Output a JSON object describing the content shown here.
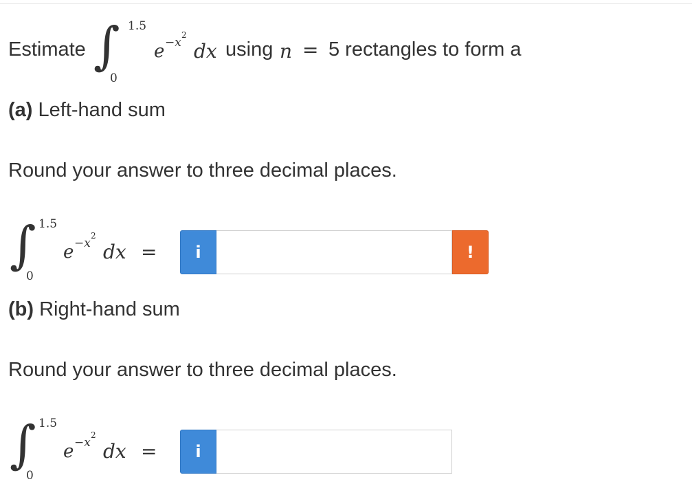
{
  "question": {
    "intro_word": "Estimate",
    "integral": {
      "upper": "1.5",
      "lower": "0",
      "base": "e",
      "exponent": "−x",
      "exponent_power": "2",
      "differential": "dx"
    },
    "middle_text": "using",
    "n_var": "n",
    "equals": "=",
    "tail_text": "5 rectangles to form a"
  },
  "part_a": {
    "label": "(a)",
    "title": "Left-hand sum",
    "instruction": "Round your answer to three decimal places.",
    "integral": {
      "upper": "1.5",
      "lower": "0",
      "base": "e",
      "exponent": "−x",
      "exponent_power": "2",
      "differential": "dx",
      "equals": "="
    },
    "info_icon": "info-icon",
    "info_glyph": "i",
    "answer_value": "",
    "warning_icon": "exclamation-icon",
    "warning_glyph": "!"
  },
  "part_b": {
    "label": "(b)",
    "title": "Right-hand sum",
    "instruction": "Round your answer to three decimal places.",
    "integral": {
      "upper": "1.5",
      "lower": "0",
      "base": "e",
      "exponent": "−x",
      "exponent_power": "2",
      "differential": "dx",
      "equals": "="
    },
    "info_icon": "info-icon",
    "info_glyph": "i",
    "answer_value": ""
  },
  "colors": {
    "info_blue": "#3f8ad9",
    "warning_orange": "#ec6a2d",
    "text": "#333333"
  }
}
